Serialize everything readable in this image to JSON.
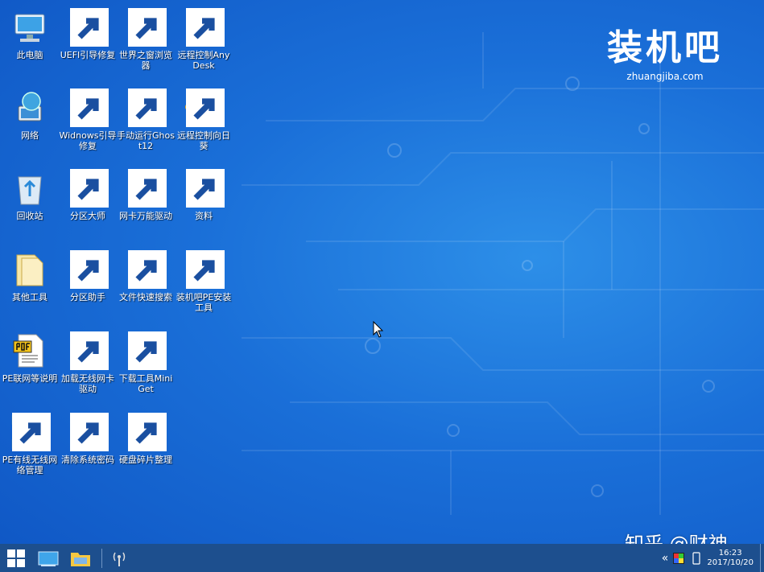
{
  "desktop": {
    "icons": [
      {
        "label": "此电脑",
        "icon": "computer-icon"
      },
      {
        "label": "UEFI引导修复",
        "icon": "monitor-repair-icon"
      },
      {
        "label": "世界之窗浏览器",
        "icon": "globe-browser-icon"
      },
      {
        "label": "远程控制AnyDesk",
        "icon": "anydesk-icon"
      },
      {
        "label": "网络",
        "icon": "network-globe-icon"
      },
      {
        "label": "Widnows引导修复",
        "icon": "medkit-icon"
      },
      {
        "label": "手动运行Ghost12",
        "icon": "ghost-icon"
      },
      {
        "label": "远程控制向日葵",
        "icon": "sunflower-icon"
      },
      {
        "label": "回收站",
        "icon": "recycle-bin-icon"
      },
      {
        "label": "分区大师",
        "icon": "partition-master-icon"
      },
      {
        "label": "网卡万能驱动",
        "icon": "wan-driver-icon"
      },
      {
        "label": "资料",
        "icon": "folder-icon"
      },
      {
        "label": "其他工具",
        "icon": "folder-icon"
      },
      {
        "label": "分区助手",
        "icon": "disk-pie-icon"
      },
      {
        "label": "文件快速搜索",
        "icon": "file-search-icon"
      },
      {
        "label": "装机吧PE安装工具",
        "icon": "zhuangjiba-tool-icon"
      },
      {
        "label": "PE联网等说明",
        "icon": "pdf-icon"
      },
      {
        "label": "加载无线网卡驱动",
        "icon": "signal-bars-icon"
      },
      {
        "label": "下载工具MiniGet",
        "icon": "fish-icon"
      },
      {
        "label": "PE有线无线网络管理",
        "icon": "network-topology-icon"
      },
      {
        "label": "清除系统密码",
        "icon": "nt-key-icon"
      },
      {
        "label": "硬盘碎片整理",
        "icon": "defrag-blocks-icon"
      }
    ]
  },
  "brand": {
    "title": "装机吧",
    "site": "zhuangjiba.com"
  },
  "watermark": "知乎 @财神",
  "taskbar": {
    "start": "windows-start-icon",
    "pinned": [
      "desktop-icon",
      "file-explorer-icon"
    ],
    "tray_app": "wireless-antenna-icon",
    "time": "16:23",
    "date": "2017/10/20"
  },
  "colors": {
    "desktop": "#1a6fd8",
    "taskbar": "#1d4f8e"
  }
}
